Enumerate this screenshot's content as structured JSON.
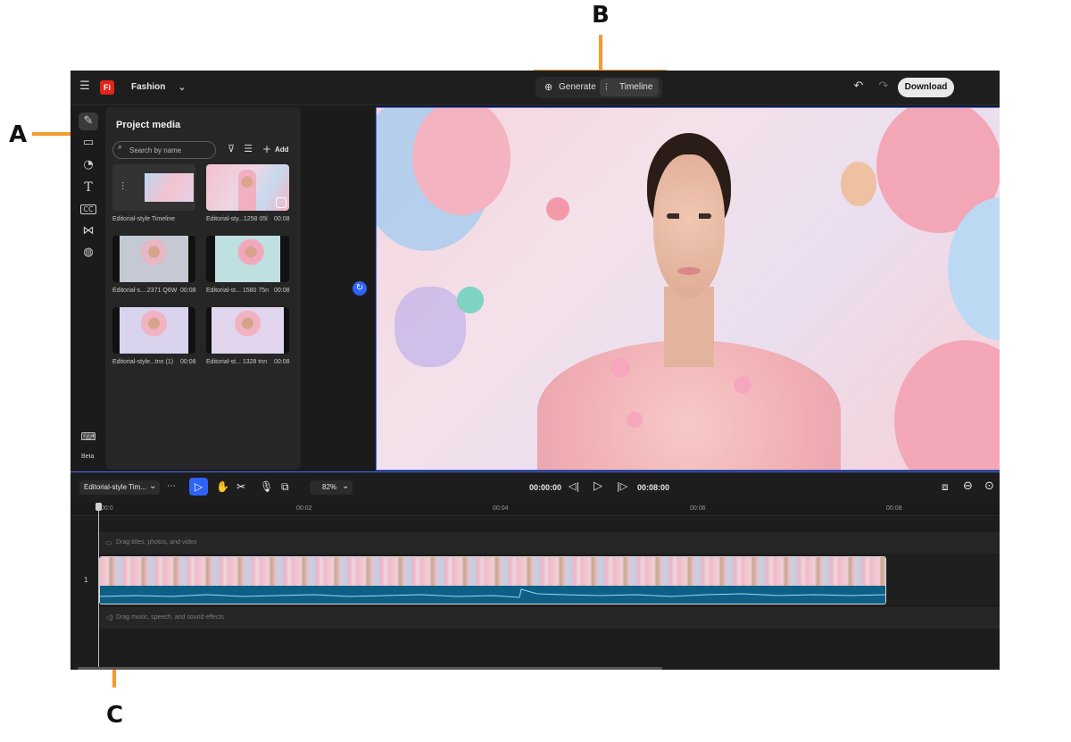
{
  "annotations": {
    "a": "A",
    "b": "B",
    "c": "C"
  },
  "topbar": {
    "menu_icon": "hamburger-icon",
    "app_badge": "Fi",
    "project_name": "Fashion",
    "tabs": [
      {
        "label": "Generate",
        "icon": "generate-icon"
      },
      {
        "label": "Timeline",
        "icon": "timeline-icon"
      }
    ],
    "download_label": "Download"
  },
  "rail": {
    "items": [
      {
        "name": "edit-icon"
      },
      {
        "name": "folder-icon"
      },
      {
        "name": "shapes-icon"
      },
      {
        "name": "text-icon"
      },
      {
        "name": "captions-icon"
      },
      {
        "name": "transitions-icon"
      },
      {
        "name": "stickers-icon"
      }
    ],
    "keyboard_icon": "keyboard-icon",
    "beta_label": "Beta"
  },
  "media_panel": {
    "title": "Project media",
    "search_placeholder": "Search by name",
    "add_label": "Add",
    "items": [
      {
        "caption": "Editorial-style Timeline",
        "duration": ""
      },
      {
        "caption": "Editorial-sty...1258 05l",
        "duration": "00:08"
      },
      {
        "caption": "Editorial-s....2371 Q6W",
        "duration": "00:08"
      },
      {
        "caption": "Editorial-st... 1580 75n",
        "duration": "00:08"
      },
      {
        "caption": "Editorial-style...tnn (1)",
        "duration": "00:08"
      },
      {
        "caption": "Editorial-st... 1328 tnn",
        "duration": "00:08"
      }
    ]
  },
  "timeline": {
    "sequence_name": "Editorial-style Tim...",
    "zoom": "82%",
    "current_time": "00:00:00",
    "total_time": "00:08:00",
    "ruler": [
      "00:0",
      "00:02",
      "00:04",
      "00:06",
      "00:08"
    ],
    "title_track_hint": "Drag titles, photos, and video",
    "track_number": "1",
    "audio_track_hint": "Drag music, speech, and sound effects"
  },
  "colors": {
    "accent": "#4a6cf7",
    "annotation": "#f59a2b",
    "badge": "#e1251b",
    "waveform": "#0d5f85"
  }
}
